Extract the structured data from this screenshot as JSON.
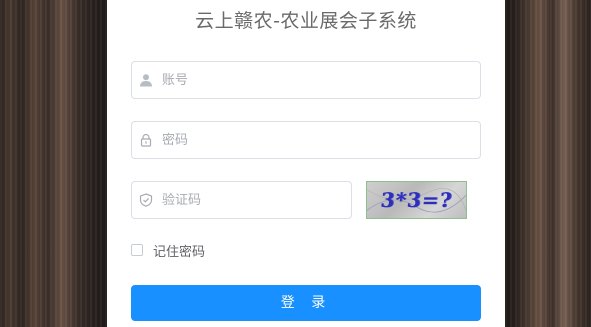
{
  "title": "云上赣农-农业展会子系统",
  "form": {
    "account_placeholder": "账号",
    "password_placeholder": "密码",
    "captcha_placeholder": "验证码",
    "captcha_text": "3*3=?",
    "remember_label": "记住密码",
    "remember_checked": false,
    "login_label": "登 录"
  },
  "icons": {
    "account": "user-icon",
    "password": "lock-icon",
    "captcha": "shield-icon"
  },
  "colors": {
    "primary": "#1890ff",
    "border": "#dcdfe6",
    "placeholder": "#a8abb2",
    "captcha_text": "#2d2fb8"
  }
}
